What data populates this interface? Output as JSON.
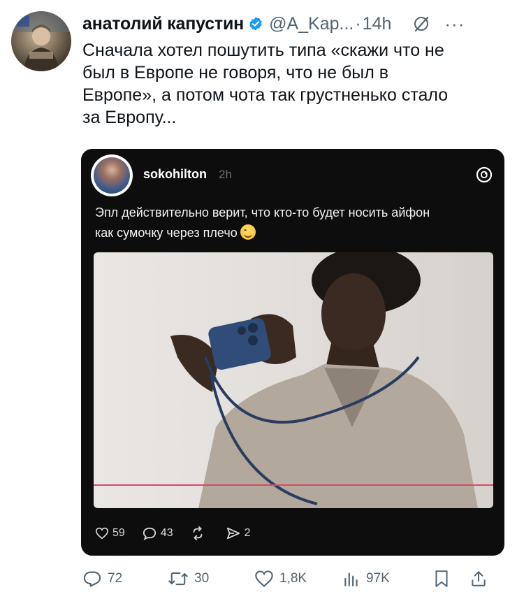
{
  "author": {
    "name": "анатолий капустин",
    "handle": "@A_Kap...",
    "separator": "·",
    "time": "14h"
  },
  "tweet": {
    "text": "Сначала хотел пошутить типа «скажи что не\nбыл в Европе не говоря, что не был в\nЕвропе», а потом чота так грустненько стало\nза Европу..."
  },
  "quote": {
    "username": "sokohilton",
    "time": "2h",
    "text": "Эпл действительно верит, что кто-то будет носить айфон\nкак сумочку через плечо",
    "emoji_icon": "smiling-face-icon",
    "actions": {
      "likes": "59",
      "replies": "43",
      "reposts": "",
      "shares": "2"
    }
  },
  "stats": {
    "replies": "72",
    "retweets": "30",
    "likes": "1,8K",
    "views": "97K"
  },
  "colors": {
    "verified": "#1d9bf0",
    "secondary_text": "#536471",
    "quote_background": "#0d0d0d",
    "image_line": "#d94a63"
  }
}
